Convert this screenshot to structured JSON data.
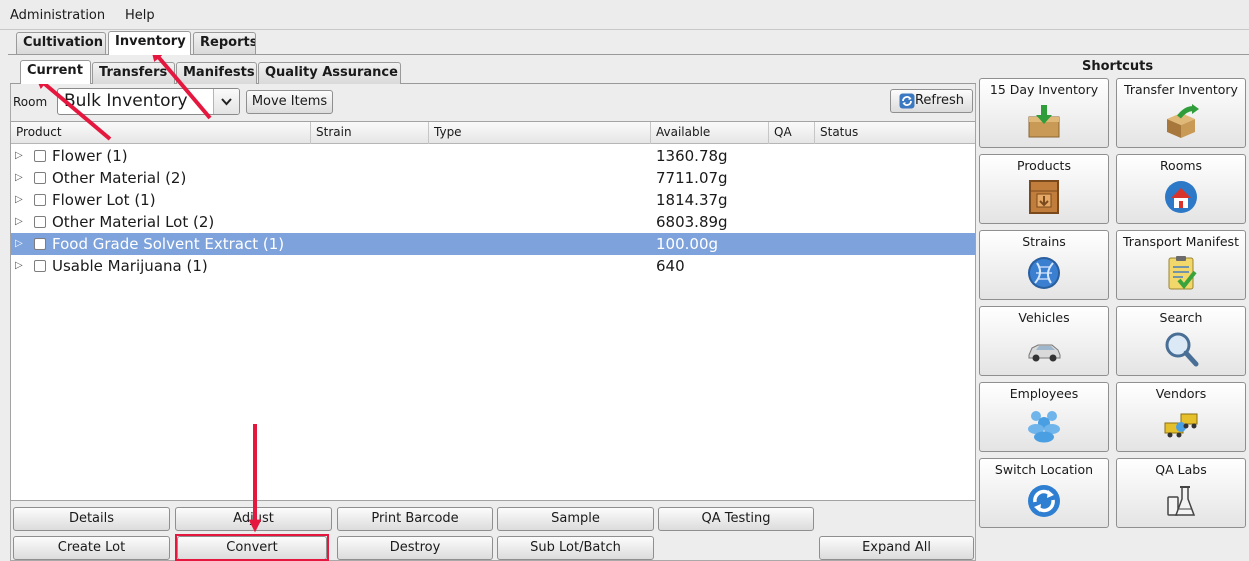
{
  "menubar": {
    "items": [
      "Administration",
      "Help"
    ]
  },
  "main_tabs": [
    "Cultivation",
    "Inventory",
    "Reports"
  ],
  "sub_tabs": [
    "Current",
    "Transfers",
    "Manifests",
    "Quality Assurance"
  ],
  "toolbar": {
    "room_label": "Room",
    "room_value": "Bulk Inventory",
    "move_items": "Move Items",
    "refresh": "Refresh"
  },
  "table": {
    "columns": [
      "Product",
      "Strain",
      "Type",
      "Available",
      "QA",
      "Status"
    ],
    "rows": [
      {
        "product": "Flower (1)",
        "available": "1360.78g",
        "selected": false
      },
      {
        "product": "Other Material (2)",
        "available": "7711.07g",
        "selected": false
      },
      {
        "product": "Flower Lot (1)",
        "available": "1814.37g",
        "selected": false
      },
      {
        "product": "Other Material Lot (2)",
        "available": "6803.89g",
        "selected": false
      },
      {
        "product": "Food Grade Solvent Extract (1)",
        "available": "100.00g",
        "selected": true
      },
      {
        "product": "Usable Marijuana (1)",
        "available": "640",
        "selected": false
      }
    ]
  },
  "actions": {
    "details": "Details",
    "adjust": "Adjust",
    "print_barcode": "Print Barcode",
    "sample": "Sample",
    "qa_testing": "QA Testing",
    "create_lot": "Create Lot",
    "convert": "Convert",
    "destroy": "Destroy",
    "sub_lot": "Sub Lot/Batch",
    "expand_all": "Expand All"
  },
  "shortcuts": {
    "title": "Shortcuts",
    "items": [
      {
        "label": "15 Day Inventory",
        "icon": "inventory-box-icon"
      },
      {
        "label": "Transfer Inventory",
        "icon": "transfer-box-icon"
      },
      {
        "label": "Products",
        "icon": "products-crate-icon"
      },
      {
        "label": "Rooms",
        "icon": "rooms-house-icon"
      },
      {
        "label": "Strains",
        "icon": "strains-dna-icon"
      },
      {
        "label": "Transport Manifest",
        "icon": "manifest-clipboard-icon"
      },
      {
        "label": "Vehicles",
        "icon": "vehicle-car-icon"
      },
      {
        "label": "Search",
        "icon": "search-magnifier-icon"
      },
      {
        "label": "Employees",
        "icon": "employees-people-icon"
      },
      {
        "label": "Vendors",
        "icon": "vendors-trucks-icon"
      },
      {
        "label": "Switch Location",
        "icon": "switch-location-icon"
      },
      {
        "label": "QA Labs",
        "icon": "qa-labs-flask-icon"
      }
    ]
  },
  "colors": {
    "selection": "#7ea3dc",
    "annotation_red": "#e5173f"
  }
}
